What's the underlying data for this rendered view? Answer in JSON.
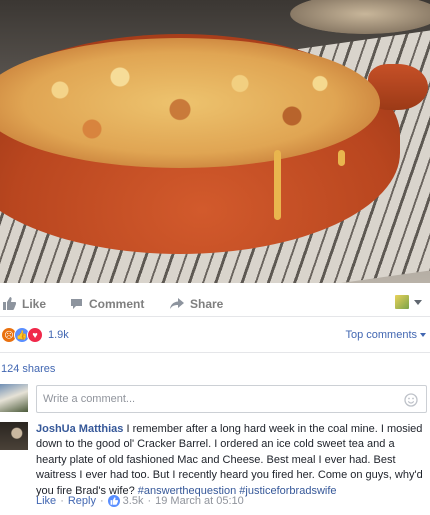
{
  "post": {
    "image_alt_icon": "mac-and-cheese-photo"
  },
  "actions": {
    "like_label": "Like",
    "comment_label": "Comment",
    "share_label": "Share"
  },
  "reactions": {
    "icons": [
      "angry-reaction-icon",
      "like-reaction-icon",
      "love-reaction-icon"
    ],
    "count": "1.9k",
    "sort_label": "Top comments"
  },
  "shares": {
    "label": "124 shares"
  },
  "composer": {
    "placeholder": "Write a comment..."
  },
  "comment": {
    "author": "JoshUa Matthias",
    "text": "I remember after a long hard week in the coal mine. I mosied down to the good ol' Cracker Barrel. I ordered an ice cold sweet tea and a hearty plate of old fashioned Mac and Cheese. Best meal I ever had. Best waitress I ever had too. But I recently heard you fired her. Come on guys, why'd you fire Brad's wife?",
    "hashtag1": "#answerthequestion",
    "hashtag2": "#justiceforbradswife",
    "like_label": "Like",
    "reply_label": "Reply",
    "like_count": "3.5k",
    "timestamp": "19 March at 05:10",
    "separator": "·"
  },
  "colors": {
    "link_blue": "#4267b2",
    "author_blue": "#365899",
    "muted_gray": "#90949c"
  }
}
